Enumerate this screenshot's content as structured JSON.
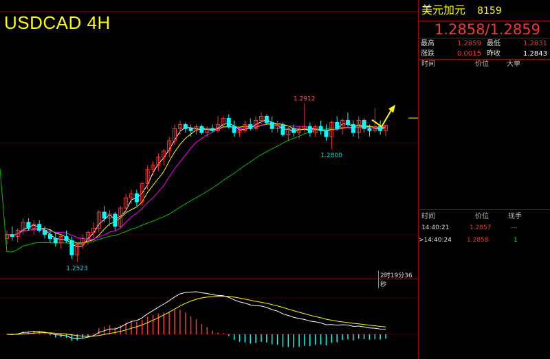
{
  "title": "USDCAD 4H",
  "timer": "2时19分36秒",
  "panel": {
    "name": "美元加元",
    "code": "8159",
    "price": "1.2858/1.2859",
    "high_label": "最高",
    "high": "1.2859",
    "low_label": "最低",
    "low": "1.2831",
    "change_label": "涨跌",
    "change": "0.0015",
    "prev_label": "昨收",
    "prev": "1.2843",
    "ticks_headers": [
      "时间",
      "价位",
      "大单"
    ],
    "trades_headers": [
      "时间",
      "价位",
      "现手"
    ],
    "trades": [
      {
        "time": "14:40:21",
        "price": "1.2857",
        "vol": "---"
      },
      {
        "time": ">14:40:24",
        "price": "1.2858",
        "vol": "1"
      }
    ]
  },
  "colors": {
    "up": "#ff3232",
    "down": "#00ffff",
    "ma_white": "#ffffff",
    "ma_yellow": "#ffff00",
    "ma_magenta": "#ff00ff",
    "ma_green": "#00c000",
    "grid": "#a00000"
  },
  "chart_data": {
    "type": "candlestick",
    "annotations": [
      {
        "text": "1.2912",
        "kind": "high"
      },
      {
        "text": "1.2800",
        "kind": "low"
      },
      {
        "text": "1.2523",
        "kind": "low"
      }
    ],
    "price_range": [
      1.2505,
      1.2955
    ],
    "candles": [
      [
        1.258,
        1.26,
        1.2565,
        1.259
      ],
      [
        1.259,
        1.261,
        1.2575,
        1.2585
      ],
      [
        1.2585,
        1.2605,
        1.257,
        1.26
      ],
      [
        1.26,
        1.263,
        1.259,
        1.262
      ],
      [
        1.262,
        1.263,
        1.26,
        1.2605
      ],
      [
        1.2605,
        1.2625,
        1.259,
        1.2615
      ],
      [
        1.2615,
        1.2625,
        1.2595,
        1.26
      ],
      [
        1.26,
        1.261,
        1.258,
        1.259
      ],
      [
        1.259,
        1.26,
        1.257,
        1.258
      ],
      [
        1.258,
        1.2595,
        1.256,
        1.257
      ],
      [
        1.257,
        1.259,
        1.2555,
        1.2585
      ],
      [
        1.2585,
        1.26,
        1.257,
        1.2575
      ],
      [
        1.2575,
        1.2585,
        1.253,
        1.254
      ],
      [
        1.254,
        1.257,
        1.2523,
        1.2565
      ],
      [
        1.2565,
        1.259,
        1.2555,
        1.258
      ],
      [
        1.258,
        1.26,
        1.2565,
        1.2595
      ],
      [
        1.2595,
        1.262,
        1.258,
        1.2605
      ],
      [
        1.2605,
        1.265,
        1.2595,
        1.2645
      ],
      [
        1.2645,
        1.266,
        1.262,
        1.263
      ],
      [
        1.263,
        1.265,
        1.261,
        1.264
      ],
      [
        1.264,
        1.2645,
        1.26,
        1.261
      ],
      [
        1.261,
        1.266,
        1.2605,
        1.2655
      ],
      [
        1.2655,
        1.269,
        1.264,
        1.268
      ],
      [
        1.268,
        1.27,
        1.2665,
        1.269
      ],
      [
        1.269,
        1.27,
        1.266,
        1.267
      ],
      [
        1.267,
        1.272,
        1.266,
        1.2715
      ],
      [
        1.2715,
        1.276,
        1.27,
        1.275
      ],
      [
        1.275,
        1.277,
        1.2735,
        1.276
      ],
      [
        1.276,
        1.279,
        1.2745,
        1.278
      ],
      [
        1.278,
        1.28,
        1.276,
        1.2795
      ],
      [
        1.2795,
        1.283,
        1.278,
        1.282
      ],
      [
        1.282,
        1.286,
        1.281,
        1.285
      ],
      [
        1.285,
        1.287,
        1.2835,
        1.286
      ],
      [
        1.286,
        1.2865,
        1.284,
        1.285
      ],
      [
        1.285,
        1.286,
        1.283,
        1.2845
      ],
      [
        1.2845,
        1.286,
        1.2835,
        1.2855
      ],
      [
        1.2855,
        1.286,
        1.2835,
        1.284
      ],
      [
        1.284,
        1.2855,
        1.283,
        1.285
      ],
      [
        1.285,
        1.286,
        1.284,
        1.2845
      ],
      [
        1.2845,
        1.288,
        1.284,
        1.286
      ],
      [
        1.286,
        1.288,
        1.2855,
        1.2875
      ],
      [
        1.2875,
        1.2885,
        1.285,
        1.2855
      ],
      [
        1.2855,
        1.287,
        1.283,
        1.284
      ],
      [
        1.284,
        1.285,
        1.283,
        1.2845
      ],
      [
        1.2845,
        1.287,
        1.284,
        1.286
      ],
      [
        1.286,
        1.2875,
        1.2845,
        1.285
      ],
      [
        1.285,
        1.288,
        1.2845,
        1.287
      ],
      [
        1.287,
        1.289,
        1.286,
        1.288
      ],
      [
        1.288,
        1.2885,
        1.286,
        1.2865
      ],
      [
        1.2865,
        1.288,
        1.284,
        1.285
      ],
      [
        1.285,
        1.287,
        1.284,
        1.286
      ],
      [
        1.286,
        1.2865,
        1.283,
        1.2835
      ],
      [
        1.2835,
        1.2855,
        1.282,
        1.285
      ],
      [
        1.285,
        1.286,
        1.283,
        1.284
      ],
      [
        1.284,
        1.2855,
        1.2825,
        1.285
      ],
      [
        1.285,
        1.2912,
        1.284,
        1.2855
      ],
      [
        1.2855,
        1.2865,
        1.283,
        1.284
      ],
      [
        1.284,
        1.286,
        1.283,
        1.2855
      ],
      [
        1.2855,
        1.287,
        1.2835,
        1.2845
      ],
      [
        1.2845,
        1.286,
        1.282,
        1.283
      ],
      [
        1.283,
        1.287,
        1.28,
        1.2865
      ],
      [
        1.2865,
        1.288,
        1.2845,
        1.285
      ],
      [
        1.285,
        1.2875,
        1.2835,
        1.287
      ],
      [
        1.287,
        1.289,
        1.2855,
        1.286
      ],
      [
        1.286,
        1.287,
        1.283,
        1.284
      ],
      [
        1.284,
        1.288,
        1.2825,
        1.287
      ],
      [
        1.287,
        1.2875,
        1.284,
        1.285
      ],
      [
        1.285,
        1.286,
        1.283,
        1.2845
      ],
      [
        1.2845,
        1.29,
        1.284,
        1.2855
      ],
      [
        1.2855,
        1.287,
        1.2835,
        1.2845
      ],
      [
        1.2845,
        1.2859,
        1.2831,
        1.2858
      ]
    ]
  }
}
